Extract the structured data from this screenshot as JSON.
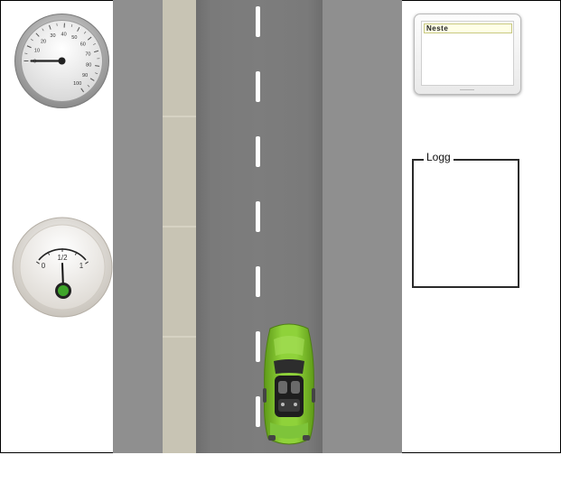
{
  "road": {
    "lane_dash_count": 8
  },
  "player_car": {
    "color": "#7cbf2a"
  },
  "speedometer": {
    "ticks": [
      "0",
      "10",
      "20",
      "30",
      "40",
      "50",
      "60",
      "70",
      "80",
      "90",
      "100"
    ],
    "value": 0
  },
  "fuel_gauge": {
    "labels": [
      "0",
      "1/2",
      "1"
    ],
    "level": 0.5,
    "indicator_color": "#3fa52a"
  },
  "next_panel": {
    "label": "Neste"
  },
  "log_panel": {
    "label": "Logg"
  }
}
